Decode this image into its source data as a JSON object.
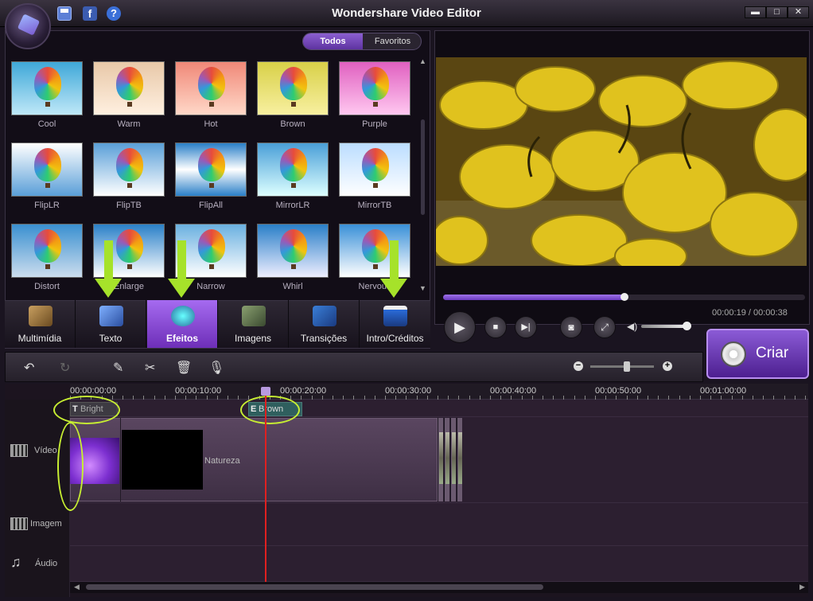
{
  "window": {
    "title": "Wondershare Video Editor"
  },
  "filter_tabs": [
    {
      "label": "Todos",
      "selected": true
    },
    {
      "label": "Favoritos",
      "selected": false
    }
  ],
  "effects": [
    {
      "label": "Cool"
    },
    {
      "label": "Warm"
    },
    {
      "label": "Hot"
    },
    {
      "label": "Brown"
    },
    {
      "label": "Purple"
    },
    {
      "label": "FlipLR"
    },
    {
      "label": "FlipTB"
    },
    {
      "label": "FlipAll"
    },
    {
      "label": "MirrorLR"
    },
    {
      "label": "MirrorTB"
    },
    {
      "label": "Distort"
    },
    {
      "label": "Enlarge"
    },
    {
      "label": "Narrow"
    },
    {
      "label": "Whirl"
    },
    {
      "label": "Nervous"
    }
  ],
  "categories": [
    {
      "label": "Multimídia",
      "icon": "film-reel-icon"
    },
    {
      "label": "Texto",
      "icon": "text-icon"
    },
    {
      "label": "Efeitos",
      "icon": "effects-icon",
      "selected": true
    },
    {
      "label": "Imagens",
      "icon": "images-icon"
    },
    {
      "label": "Transições",
      "icon": "transitions-icon"
    },
    {
      "label": "Intro/Créditos",
      "icon": "clapper-icon"
    }
  ],
  "player": {
    "current_time": "00:00:19",
    "total_time": "00:00:38",
    "progress": 0.5,
    "volume": 0.9
  },
  "create_button": {
    "label": "Criar"
  },
  "timeline": {
    "ruler": [
      "00:00:00:00",
      "00:00:10:00",
      "00:00:20:00",
      "00:00:30:00",
      "00:00:40:00",
      "00:00:50:00",
      "00:01:00:00"
    ],
    "tracks": {
      "video": "Vídeo",
      "image": "Imagem",
      "audio": "Áudio"
    },
    "text_clip": {
      "glyph": "T",
      "label": "Bright"
    },
    "effect_clip": {
      "glyph": "E",
      "label": "Brown"
    },
    "video_clip": {
      "label": "Natureza"
    }
  },
  "colors": {
    "accent": "#8b5fd0",
    "highlight": "#c7ee32",
    "arrow": "#a6e22a",
    "playhead": "#e02020"
  }
}
